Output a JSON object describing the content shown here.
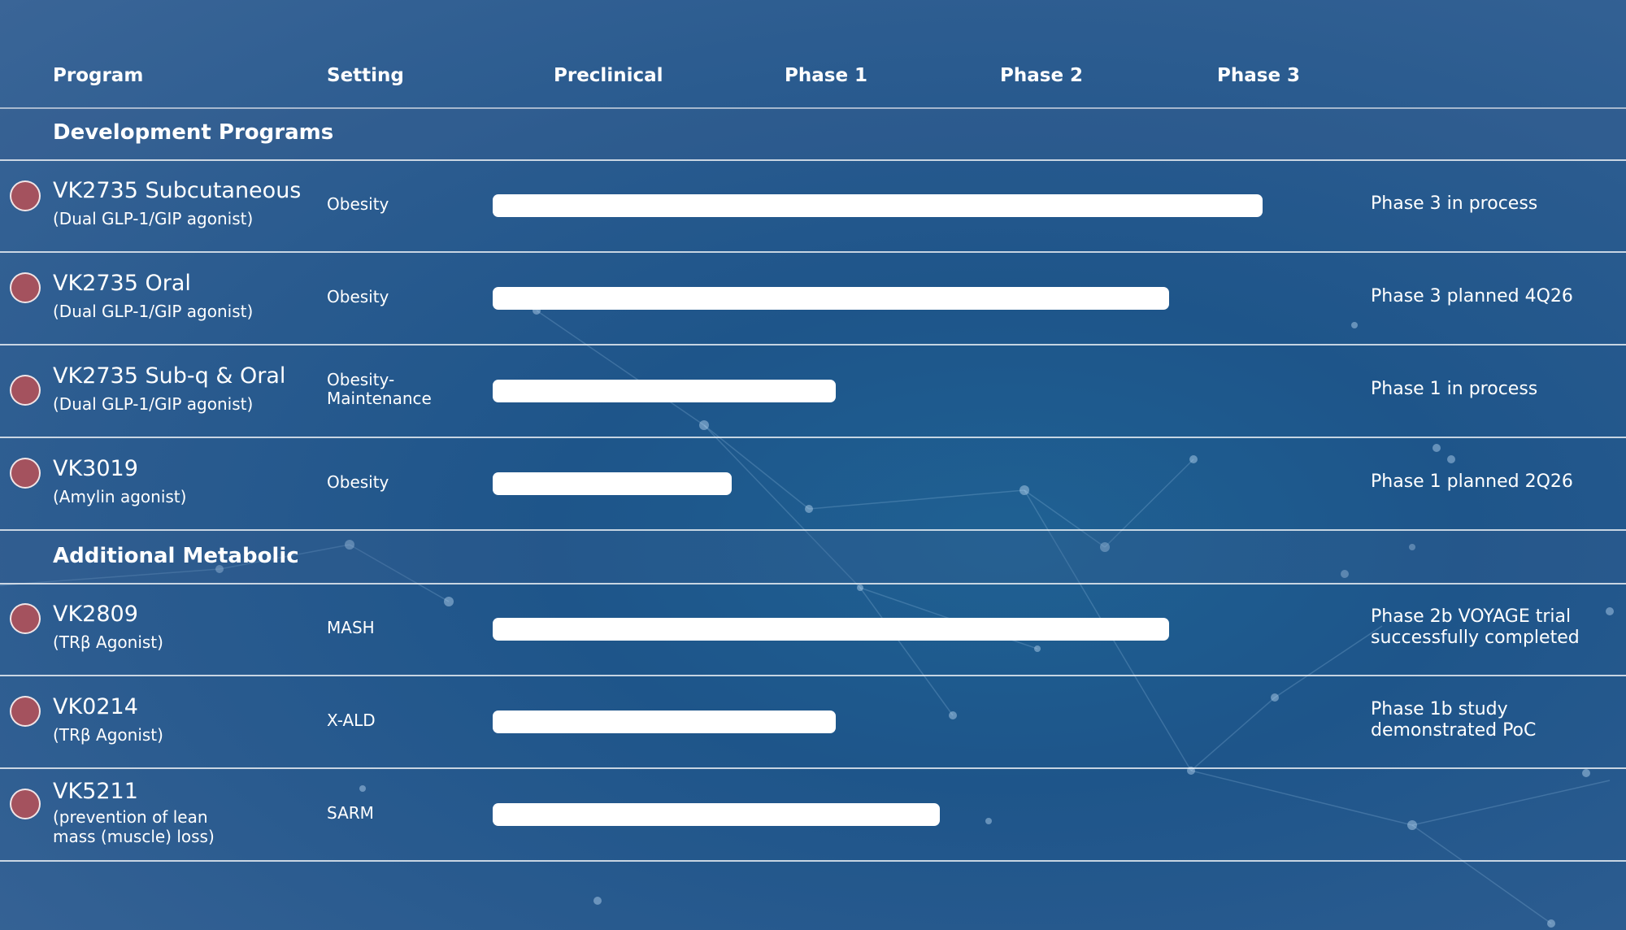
{
  "header": {
    "program": "Program",
    "setting": "Setting",
    "preclinical": "Preclinical",
    "phase1": "Phase 1",
    "phase2": "Phase 2",
    "phase3": "Phase 3"
  },
  "sections": [
    {
      "title": "Development Programs"
    },
    {
      "title": "Additional Metabolic"
    }
  ],
  "programs": [
    {
      "name": "VK2735 Subcutaneous",
      "sub": "(Dual GLP-1/GIP agonist)",
      "sub2": "",
      "setting": "Obesity",
      "setting2": "",
      "progress_phase": 3.7,
      "status": "Phase 3 in process",
      "status2": ""
    },
    {
      "name": "VK2735 Oral",
      "sub": "(Dual GLP-1/GIP agonist)",
      "sub2": "",
      "setting": "Obesity",
      "setting2": "",
      "progress_phase": 3.25,
      "status": "Phase 3 planned 4Q26",
      "status2": ""
    },
    {
      "name": "VK2735 Sub-q & Oral",
      "sub": "(Dual GLP-1/GIP agonist)",
      "sub2": "",
      "setting": "Obesity-",
      "setting2": "Maintenance",
      "progress_phase": 1.65,
      "status": "Phase 1 in process",
      "status2": ""
    },
    {
      "name": "VK3019",
      "sub": "(Amylin agonist)",
      "sub2": "",
      "setting": "Obesity",
      "setting2": "",
      "progress_phase": 1.15,
      "status": "Phase 1 planned 2Q26",
      "status2": ""
    },
    {
      "name": "VK2809",
      "sub": "(TRβ Agonist)",
      "sub2": "",
      "setting": "MASH",
      "setting2": "",
      "progress_phase": 3.25,
      "status": "Phase 2b VOYAGE trial",
      "status2": "successfully completed"
    },
    {
      "name": "VK0214",
      "sub": "(TRβ Agonist)",
      "sub2": "",
      "setting": "X-ALD",
      "setting2": "",
      "progress_phase": 1.65,
      "status": "Phase 1b study",
      "status2": "demonstrated PoC"
    },
    {
      "name": "VK5211",
      "sub": "(prevention of lean",
      "sub2": "mass (muscle) loss)",
      "setting": "SARM",
      "setting2": "",
      "progress_phase": 2.15,
      "status": "",
      "status2": ""
    }
  ],
  "colors": {
    "dot": "#a4525e",
    "bar": "#ffffff",
    "divider": "#ffffff"
  }
}
